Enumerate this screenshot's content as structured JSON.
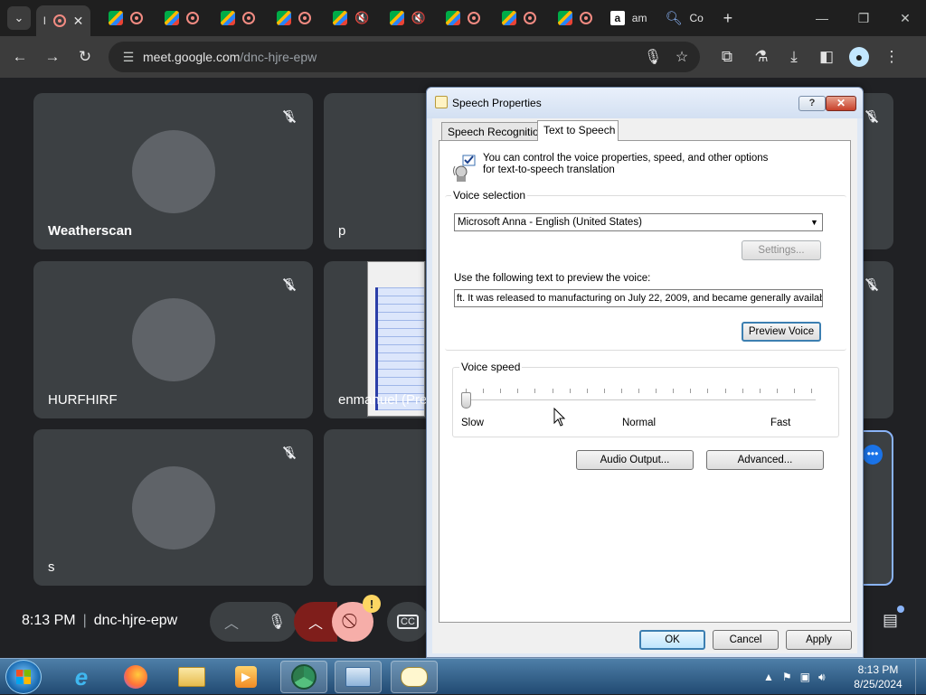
{
  "browser": {
    "tabs": [
      {
        "kind": "recording",
        "title": "l",
        "active": true
      },
      {
        "kind": "meet-recording"
      },
      {
        "kind": "meet-recording"
      },
      {
        "kind": "meet-recording"
      },
      {
        "kind": "meet-recording"
      },
      {
        "kind": "meet-muted"
      },
      {
        "kind": "meet-muted"
      },
      {
        "kind": "meet-recording"
      },
      {
        "kind": "meet-recording"
      },
      {
        "kind": "meet-recording"
      },
      {
        "kind": "amazon",
        "title": "am"
      },
      {
        "kind": "search",
        "title": "Co"
      }
    ],
    "url_host": "meet.google.com",
    "url_path": "/dnc-hjre-epw"
  },
  "meet": {
    "tiles": [
      {
        "name": "Weatherscan",
        "muted": true
      },
      {
        "name": "p",
        "muted": false
      },
      {
        "name": "HURFHIRF",
        "muted": true
      },
      {
        "name": "enmanuel (Pre",
        "muted": false
      },
      {
        "name": "s",
        "muted": true
      }
    ],
    "time": "8:13 PM",
    "meeting_code": "dnc-hjre-epw",
    "alert": "!"
  },
  "dialog": {
    "title": "Speech Properties",
    "help": "?",
    "close": "✕",
    "tabs": [
      "Speech Recognition",
      "Text to Speech"
    ],
    "intro": "You can control the voice properties, speed, and other options for text-to-speech translation",
    "voice_selection_label": "Voice selection",
    "voice": "Microsoft Anna - English (United States)",
    "settings_button": "Settings...",
    "preview_label": "Use the following text to preview the voice:",
    "preview_text": "ft. It was released to manufacturing on July 22, 2009, and became generally available",
    "preview_button": "Preview Voice",
    "voice_speed_label": "Voice speed",
    "speed_slow": "Slow",
    "speed_normal": "Normal",
    "speed_fast": "Fast",
    "speed_value": 0,
    "audio_output_button": "Audio Output...",
    "advanced_button": "Advanced...",
    "ok_button": "OK",
    "cancel_button": "Cancel",
    "apply_button": "Apply"
  },
  "taskbar": {
    "time": "8:13 PM",
    "date": "8/25/2024"
  }
}
